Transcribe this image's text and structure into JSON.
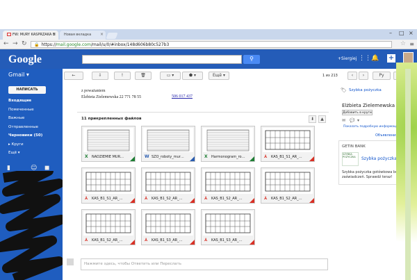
{
  "browser": {
    "tabs": [
      {
        "label": "FW: MURY KASPRZAKA B"
      },
      {
        "label": "Новая вкладка"
      }
    ],
    "url_scheme": "https://",
    "url_host": "mail.google.com",
    "url_path": "/mail/u/0/#inbox/148d606b80c527b3"
  },
  "header": {
    "logo": "Google",
    "user": "+Siergiej"
  },
  "left": {
    "app_label": "Gmail ▾",
    "compose_label": "НАПИСАТЬ",
    "nav": [
      {
        "label": "Входящие",
        "bold": true
      },
      {
        "label": "Помеченные",
        "bold": false
      },
      {
        "label": "Важные",
        "bold": false
      },
      {
        "label": "Отправленные",
        "bold": false
      },
      {
        "label": "Черновики (50)",
        "bold": true
      },
      {
        "label": "▸ Круги",
        "bold": false
      },
      {
        "label": "Ещё ▾",
        "bold": false
      }
    ]
  },
  "toolbar": {
    "more_label": "Ещё ▾",
    "count": "1 из 213",
    "lang": "Ру"
  },
  "message": {
    "greeting": "z poważaniem",
    "name_phone": "Elzbieta Zielemewska 22 771 78 55",
    "mobile": "506 017 437",
    "attachments_label": "11 прикрепленных файлов",
    "attachments": [
      {
        "name": "NADZIEMIE MUR…",
        "type": "X",
        "color": "#1e7e34"
      },
      {
        "name": "SZO_roboty_mur…",
        "type": "W",
        "color": "#2a5db0"
      },
      {
        "name": "Harmonogram_ro…",
        "type": "X",
        "color": "#1e7e34"
      },
      {
        "name": "KAS_B1_S1_AR_…",
        "type": "pdf",
        "color": "#d93025"
      },
      {
        "name": "KAS_B1_S1_AR_…",
        "type": "pdf",
        "color": "#d93025"
      },
      {
        "name": "KAS_B1_S2_AR_…",
        "type": "pdf",
        "color": "#d93025"
      },
      {
        "name": "KAS_B1_S2_AR_…",
        "type": "pdf",
        "color": "#d93025"
      },
      {
        "name": "KAS_B1_S2_AR_…",
        "type": "pdf",
        "color": "#d93025"
      },
      {
        "name": "KAS_B1_S2_AR_…",
        "type": "pdf",
        "color": "#d93025"
      },
      {
        "name": "KAS_B1_S3_AR_…",
        "type": "pdf",
        "color": "#d93025"
      },
      {
        "name": "KAS_B1_S3_AR_…",
        "type": "pdf",
        "color": "#d93025"
      }
    ],
    "reply_placeholder": "Нажмите здесь, чтобы Ответить или Переслать"
  },
  "sidebar": {
    "title": "Szybka pożyczka",
    "contact": "Elżbieta Zielemewska",
    "add_circle": "Добавить в круги",
    "more_info": "Показать подробную информацию",
    "ads_label": "Объявления",
    "ad": {
      "brand": "GETIN BANK",
      "logo_text": "SZYBKA POŻYCZKA",
      "name": "Szybka pożyczka",
      "text": "Szybka pożyczka gotówkowa bez zaświadczeń. Sprawdź teraz!"
    }
  }
}
